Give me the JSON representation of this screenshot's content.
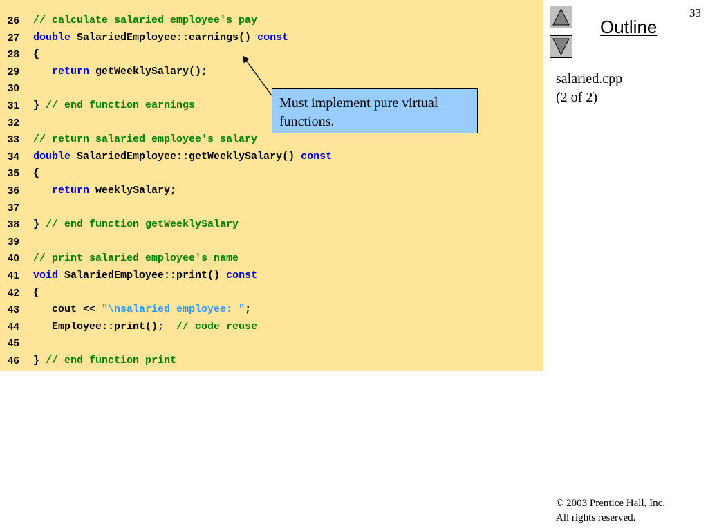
{
  "slide": {
    "page_number": "33",
    "outline_label": "Outline",
    "file_name": "salaried.cpp",
    "file_part": "(2 of 2)",
    "copyright_line1": "© 2003 Prentice Hall, Inc.",
    "copyright_line2": "All rights reserved."
  },
  "nav": {
    "up_icon": "triangle-up-icon",
    "down_icon": "triangle-down-icon"
  },
  "callout": {
    "text_line1": "Must implement pure virtual",
    "text_line2": "functions."
  },
  "colors": {
    "code_background": "#ffe599",
    "keyword": "#0000cc",
    "comment": "#008000",
    "string": "#3399ff",
    "callout_background": "#99ccff"
  },
  "code": {
    "lines": [
      {
        "num": "26",
        "segments": [
          {
            "t": "cm",
            "text": "// calculate salaried employee's pay"
          }
        ]
      },
      {
        "num": "27",
        "segments": [
          {
            "t": "kw",
            "text": "double"
          },
          {
            "t": "pl",
            "text": " SalariedEmployee::earnings() "
          },
          {
            "t": "kw",
            "text": "const"
          }
        ]
      },
      {
        "num": "28",
        "segments": [
          {
            "t": "pl",
            "text": "{"
          }
        ]
      },
      {
        "num": "29",
        "segments": [
          {
            "t": "pl",
            "text": "   "
          },
          {
            "t": "kw",
            "text": "return"
          },
          {
            "t": "pl",
            "text": " getWeeklySalary();"
          }
        ]
      },
      {
        "num": "30",
        "segments": []
      },
      {
        "num": "31",
        "segments": [
          {
            "t": "pl",
            "text": "} "
          },
          {
            "t": "cm",
            "text": "// end function earnings"
          }
        ]
      },
      {
        "num": "32",
        "segments": []
      },
      {
        "num": "33",
        "segments": [
          {
            "t": "cm",
            "text": "// return salaried employee's salary"
          }
        ]
      },
      {
        "num": "34",
        "segments": [
          {
            "t": "kw",
            "text": "double"
          },
          {
            "t": "pl",
            "text": " SalariedEmployee::getWeeklySalary() "
          },
          {
            "t": "kw",
            "text": "const"
          }
        ]
      },
      {
        "num": "35",
        "segments": [
          {
            "t": "pl",
            "text": "{"
          }
        ]
      },
      {
        "num": "36",
        "segments": [
          {
            "t": "pl",
            "text": "   "
          },
          {
            "t": "kw",
            "text": "return"
          },
          {
            "t": "pl",
            "text": " weeklySalary;"
          }
        ]
      },
      {
        "num": "37",
        "segments": []
      },
      {
        "num": "38",
        "segments": [
          {
            "t": "pl",
            "text": "} "
          },
          {
            "t": "cm",
            "text": "// end function getWeeklySalary"
          }
        ]
      },
      {
        "num": "39",
        "segments": []
      },
      {
        "num": "40",
        "segments": [
          {
            "t": "cm",
            "text": "// print salaried employee's name"
          }
        ]
      },
      {
        "num": "41",
        "segments": [
          {
            "t": "kw",
            "text": "void"
          },
          {
            "t": "pl",
            "text": " SalariedEmployee::print() "
          },
          {
            "t": "kw",
            "text": "const"
          }
        ]
      },
      {
        "num": "42",
        "segments": [
          {
            "t": "pl",
            "text": "{"
          }
        ]
      },
      {
        "num": "43",
        "segments": [
          {
            "t": "pl",
            "text": "   cout << "
          },
          {
            "t": "st",
            "text": "\"\\nsalaried employee: \""
          },
          {
            "t": "pl",
            "text": ";"
          }
        ]
      },
      {
        "num": "44",
        "segments": [
          {
            "t": "pl",
            "text": "   Employee::print();  "
          },
          {
            "t": "cm",
            "text": "// code reuse"
          }
        ]
      },
      {
        "num": "45",
        "segments": []
      },
      {
        "num": "46",
        "segments": [
          {
            "t": "pl",
            "text": "} "
          },
          {
            "t": "cm",
            "text": "// end function print"
          }
        ]
      }
    ]
  }
}
